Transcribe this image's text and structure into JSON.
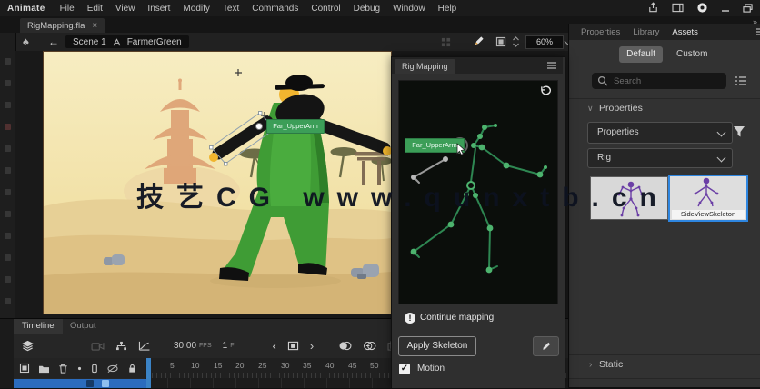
{
  "app": {
    "name": "Animate"
  },
  "menubar": {
    "items": [
      "File",
      "Edit",
      "View",
      "Insert",
      "Modify",
      "Text",
      "Commands",
      "Control",
      "Debug",
      "Window",
      "Help"
    ]
  },
  "doc_tab": {
    "title": "RigMapping.fla"
  },
  "edit_bar": {
    "scene": "Scene 1",
    "symbol": "FarmerGreen",
    "zoom_value": "60%"
  },
  "stage": {
    "bone_label": "Far_UpperArm"
  },
  "watermark": "技艺CG www.qunxtb.cn",
  "rig_mapping_panel": {
    "title": "Rig Mapping",
    "tooltip": "Far_UpperArm",
    "status_text": "Continue mapping",
    "apply_button": "Apply Skeleton",
    "motion_checkbox": "Motion"
  },
  "assets_panel": {
    "tab_properties": "Properties",
    "tab_library": "Library",
    "tab_assets": "Assets",
    "subtab_default": "Default",
    "subtab_custom": "Custom",
    "search_placeholder": "Search",
    "section_properties": "Properties",
    "dropdown_properties": "Properties",
    "dropdown_rig": "Rig",
    "thumbnail_selected_label": "SideViewSkeleton",
    "section_static": "Static"
  },
  "timeline": {
    "tab_timeline": "Timeline",
    "tab_output": "Output",
    "fps_value": "30.00",
    "fps_unit": "FPS",
    "frame_value": "1",
    "frame_unit": "F",
    "ruler": [
      "5",
      "10",
      "15",
      "20",
      "25",
      "30",
      "35",
      "40",
      "45",
      "50"
    ]
  },
  "icons": {
    "close": "×",
    "back": "←",
    "collapse": "»",
    "prev": "‹",
    "next": "›",
    "check": "✓",
    "alert": "!",
    "section_open": "∨",
    "section_closed": "›"
  }
}
